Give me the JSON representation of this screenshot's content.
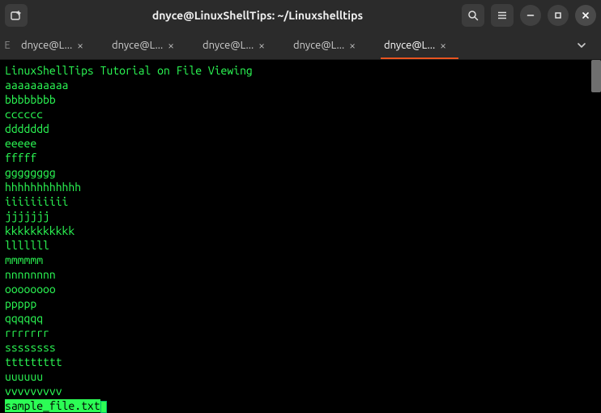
{
  "titlebar": {
    "title": "dnyce@LinuxShellTips: ~/Linuxshelltips"
  },
  "edge_letter": "E",
  "tabs": [
    {
      "label": "dnyce@L...",
      "active": false
    },
    {
      "label": "dnyce@L...",
      "active": false
    },
    {
      "label": "dnyce@L...",
      "active": false
    },
    {
      "label": "dnyce@L...",
      "active": false
    },
    {
      "label": "dnyce@L...",
      "active": true
    }
  ],
  "terminal_lines": [
    "LinuxShellTips Tutorial on File Viewing",
    "aaaaaaaaaa",
    "bbbbbbbb",
    "cccccc",
    "ddddddd",
    "eeeee",
    "fffff",
    "gggggggg",
    "hhhhhhhhhhhh",
    "iiiiiiiiii",
    "jjjjjjj",
    "kkkkkkkkkkk",
    "lllllll",
    "mmmmmm",
    "nnnnnnnn",
    "oooooooo",
    "ppppp",
    "qqqqqq",
    "rrrrrrr",
    "ssssssss",
    "ttttttttt",
    "uuuuuu",
    "vvvvvvvvv"
  ],
  "status_filename": "sample_file.txt",
  "icons": {
    "newtab": "new-tab-icon",
    "search": "search-icon",
    "menu": "hamburger-icon",
    "minimize": "minimize-icon",
    "maximize": "maximize-icon",
    "close": "close-icon",
    "tabclose": "tab-close-icon",
    "chevdown": "chevron-down-icon"
  }
}
